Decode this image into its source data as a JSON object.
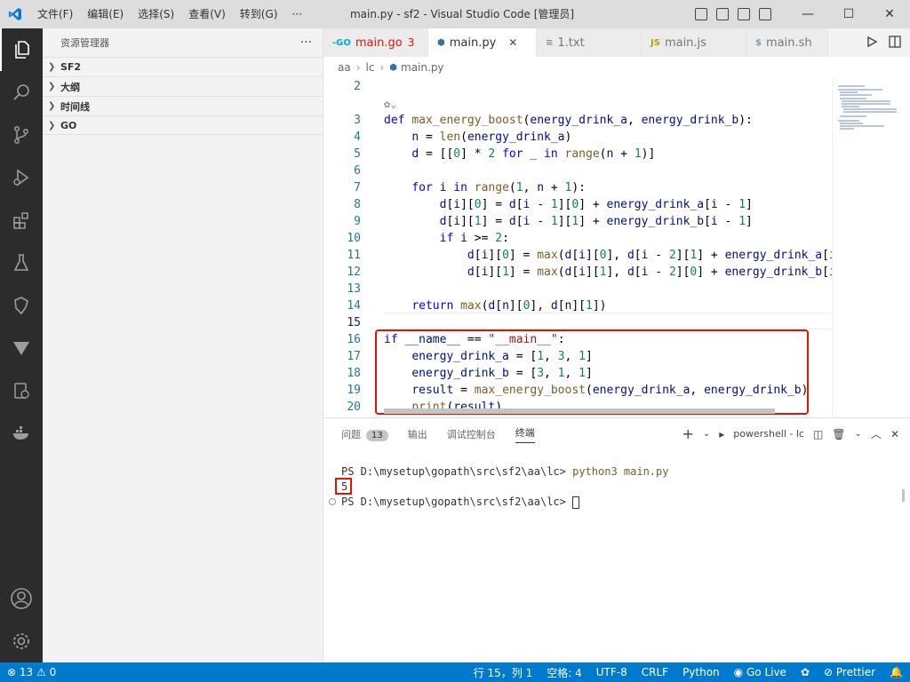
{
  "window": {
    "title": "main.py - sf2 - Visual Studio Code [管理员]"
  },
  "menu": [
    "文件(F)",
    "编辑(E)",
    "选择(S)",
    "查看(V)",
    "转到(G)",
    "···"
  ],
  "sidebar": {
    "title": "资源管理器",
    "sections": [
      "SF2",
      "大纲",
      "时间线",
      "GO"
    ]
  },
  "tabs": [
    {
      "label": "main.go",
      "badge": "3",
      "icon": "go-file-icon",
      "icon_text": "-GO"
    },
    {
      "label": "main.py",
      "icon": "python-file-icon",
      "icon_text": "⬢"
    },
    {
      "label": "1.txt",
      "icon": "text-file-icon",
      "icon_text": "≡"
    },
    {
      "label": "main.js",
      "icon": "js-file-icon",
      "icon_text": "JS"
    },
    {
      "label": "main.sh",
      "icon": "shell-file-icon",
      "icon_text": "$"
    }
  ],
  "breadcrumb": [
    "aa",
    "lc",
    "main.py"
  ],
  "code_lines": [
    {
      "n": "2",
      "html": ""
    },
    {
      "n": "3",
      "html": "<span class='kw'>def</span> <span class='fn'>max_energy_boost</span>(<span class='var'>energy_drink_a</span>, <span class='var'>energy_drink_b</span>):"
    },
    {
      "n": "4",
      "html": "    <span class='var'>n</span> = <span class='fn'>len</span>(<span class='var'>energy_drink_a</span>)"
    },
    {
      "n": "5",
      "html": "    <span class='var'>d</span> = [[<span class='num'>0</span>] * <span class='num'>2</span> <span class='kw'>for</span> <span class='var'>_</span> <span class='kw'>in</span> <span class='fn'>range</span>(<span class='var'>n</span> + <span class='num'>1</span>)]"
    },
    {
      "n": "6",
      "html": ""
    },
    {
      "n": "7",
      "html": "    <span class='kw'>for</span> <span class='var'>i</span> <span class='kw'>in</span> <span class='fn'>range</span>(<span class='num'>1</span>, <span class='var'>n</span> + <span class='num'>1</span>):"
    },
    {
      "n": "8",
      "html": "        <span class='var'>d</span>[<span class='var'>i</span>][<span class='num'>0</span>] = <span class='var'>d</span>[<span class='var'>i</span> - <span class='num'>1</span>][<span class='num'>0</span>] + <span class='var'>energy_drink_a</span>[<span class='var'>i</span> - <span class='num'>1</span>]"
    },
    {
      "n": "9",
      "html": "        <span class='var'>d</span>[<span class='var'>i</span>][<span class='num'>1</span>] = <span class='var'>d</span>[<span class='var'>i</span> - <span class='num'>1</span>][<span class='num'>1</span>] + <span class='var'>energy_drink_b</span>[<span class='var'>i</span> - <span class='num'>1</span>]"
    },
    {
      "n": "10",
      "html": "        <span class='kw'>if</span> <span class='var'>i</span> >= <span class='num'>2</span>:"
    },
    {
      "n": "11",
      "html": "            <span class='var'>d</span>[<span class='var'>i</span>][<span class='num'>0</span>] = <span class='fn'>max</span>(<span class='var'>d</span>[<span class='var'>i</span>][<span class='num'>0</span>], <span class='var'>d</span>[<span class='var'>i</span> - <span class='num'>2</span>][<span class='num'>1</span>] + <span class='var'>energy_drink_a</span>[<span class='var'>i</span>"
    },
    {
      "n": "12",
      "html": "            <span class='var'>d</span>[<span class='var'>i</span>][<span class='num'>1</span>] = <span class='fn'>max</span>(<span class='var'>d</span>[<span class='var'>i</span>][<span class='num'>1</span>], <span class='var'>d</span>[<span class='var'>i</span> - <span class='num'>2</span>][<span class='num'>0</span>] + <span class='var'>energy_drink_b</span>[<span class='var'>i</span>"
    },
    {
      "n": "13",
      "html": ""
    },
    {
      "n": "14",
      "html": "    <span class='kw'>return</span> <span class='fn'>max</span>(<span class='var'>d</span>[<span class='var'>n</span>][<span class='num'>0</span>], <span class='var'>d</span>[<span class='var'>n</span>][<span class='num'>1</span>])"
    },
    {
      "n": "15",
      "html": ""
    },
    {
      "n": "16",
      "html": "<span class='kw'>if</span> <span class='var'>__name__</span> == <span class='str'>\"__main__\"</span>:"
    },
    {
      "n": "17",
      "html": "    <span class='var'>energy_drink_a</span> = [<span class='num'>1</span>, <span class='num'>3</span>, <span class='num'>1</span>]"
    },
    {
      "n": "18",
      "html": "    <span class='var'>energy_drink_b</span> = [<span class='num'>3</span>, <span class='num'>1</span>, <span class='num'>1</span>]"
    },
    {
      "n": "19",
      "html": "    <span class='var'>result</span> = <span class='fn'>max_energy_boost</span>(<span class='var'>energy_drink_a</span>, <span class='var'>energy_drink_b</span>)"
    },
    {
      "n": "20",
      "html": "    <span class='fn'>print</span>(<span class='var'>result</span>)"
    }
  ],
  "panel": {
    "tabs": [
      "问题",
      "输出",
      "调试控制台",
      "终端"
    ],
    "problems_count": "13",
    "terminal_name": "powershell - lc",
    "terminal_lines": [
      {
        "prompt": "PS D:\\mysetup\\gopath\\src\\sf2\\aa\\lc> ",
        "cmd": "python3 main.py"
      },
      {
        "prompt": "5",
        "cmd": ""
      },
      {
        "prompt": "PS D:\\mysetup\\gopath\\src\\sf2\\aa\\lc> ",
        "cmd": ""
      }
    ]
  },
  "status": {
    "errors": "13",
    "warnings": "0",
    "position": "行 15，列 1",
    "spaces": "空格: 4",
    "encoding": "UTF-8",
    "eol": "CRLF",
    "language": "Python",
    "golive": "Go Live",
    "prettier": "Prettier"
  },
  "colors": {
    "statusbar": "#007acc",
    "activitybar": "#2c2c2c",
    "highlight": "#e51400"
  }
}
